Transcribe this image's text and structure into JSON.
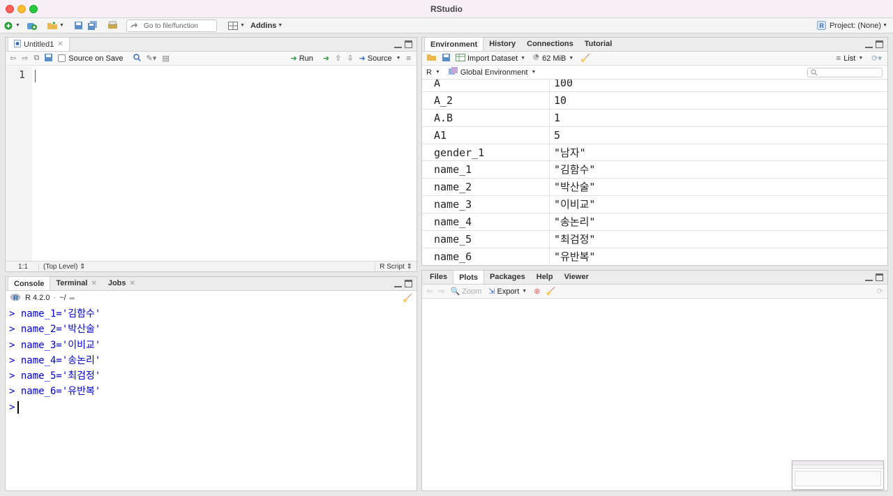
{
  "window": {
    "title": "RStudio"
  },
  "toolbar": {
    "goto_placeholder": "Go to file/function",
    "addins_label": "Addins",
    "project_label": "Project: (None)"
  },
  "editor": {
    "tab_label": "Untitled1",
    "source_on_save": "Source on Save",
    "run_label": "Run",
    "source_label": "Source",
    "line_number": "1",
    "status_position": "1:1",
    "status_scope": "(Top Level)",
    "status_type": "R Script"
  },
  "console_pane": {
    "tabs": [
      {
        "label": "Console"
      },
      {
        "label": "Terminal"
      },
      {
        "label": "Jobs"
      }
    ],
    "version": "R 4.2.0",
    "path": "~/",
    "lines": [
      "name_1='김함수'",
      "name_2='박산술'",
      "name_3='이비교'",
      "name_4='송논리'",
      "name_5='최검정'",
      "name_6='유반복'"
    ]
  },
  "env_pane": {
    "tabs": [
      {
        "label": "Environment"
      },
      {
        "label": "History"
      },
      {
        "label": "Connections"
      },
      {
        "label": "Tutorial"
      }
    ],
    "import_label": "Import Dataset",
    "memory_label": "62 MiB",
    "list_label": "List",
    "lang_label": "R",
    "scope_label": "Global Environment",
    "variables": [
      {
        "name": "A",
        "value": "100"
      },
      {
        "name": "A_2",
        "value": "10"
      },
      {
        "name": "A.B",
        "value": "1"
      },
      {
        "name": "A1",
        "value": "5"
      },
      {
        "name": "gender_1",
        "value": "\"남자\""
      },
      {
        "name": "name_1",
        "value": "\"김함수\""
      },
      {
        "name": "name_2",
        "value": "\"박산술\""
      },
      {
        "name": "name_3",
        "value": "\"이비교\""
      },
      {
        "name": "name_4",
        "value": "\"송논리\""
      },
      {
        "name": "name_5",
        "value": "\"최검정\""
      },
      {
        "name": "name_6",
        "value": "\"유반복\""
      }
    ]
  },
  "files_pane": {
    "tabs": [
      {
        "label": "Files"
      },
      {
        "label": "Plots"
      },
      {
        "label": "Packages"
      },
      {
        "label": "Help"
      },
      {
        "label": "Viewer"
      }
    ],
    "zoom_label": "Zoom",
    "export_label": "Export"
  }
}
